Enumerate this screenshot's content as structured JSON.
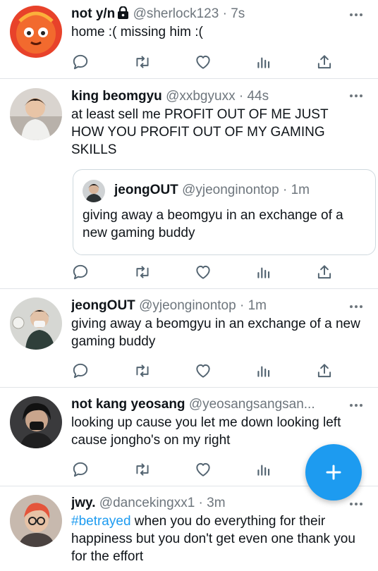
{
  "tweets": [
    {
      "name": "not y/n",
      "handle": "@sherlock123",
      "time": "7s",
      "text": "home :( missing him :("
    },
    {
      "name": "king beomgyu",
      "handle": "@xxbgyuxx",
      "time": "44s",
      "text": "at least sell me PROFIT OUT OF ME JUST HOW YOU PROFIT OUT OF MY GAMING SKILLS",
      "quote": {
        "name": "jeongOUT",
        "handle": "@yjeonginontop",
        "time": "1m",
        "text": "giving away a beomgyu in an exchange of a new gaming buddy"
      }
    },
    {
      "name": "jeongOUT",
      "handle": "@yjeonginontop",
      "time": "1m",
      "text": "giving away a beomgyu in an exchange of a new gaming buddy"
    },
    {
      "name": "not kang yeosang",
      "handle": "@yeosangsangsan...",
      "text": "looking up cause you let me down looking left cause jongho's on my right"
    },
    {
      "name": "jwy.",
      "handle": "@dancekingxx1",
      "time": "3m",
      "hashtag": "#betrayed",
      "text": " when you do everything for their happiness but you don't get even one thank you for the effort"
    }
  ],
  "separator": "·",
  "colors": {
    "accent": "#1d9bf0",
    "secondary": "#6e767d",
    "border": "#e1e4e8"
  },
  "icons": [
    "lock-icon",
    "more-icon",
    "reply-icon",
    "retweet-icon",
    "like-icon",
    "analytics-icon",
    "share-icon",
    "compose-plus-icon"
  ]
}
